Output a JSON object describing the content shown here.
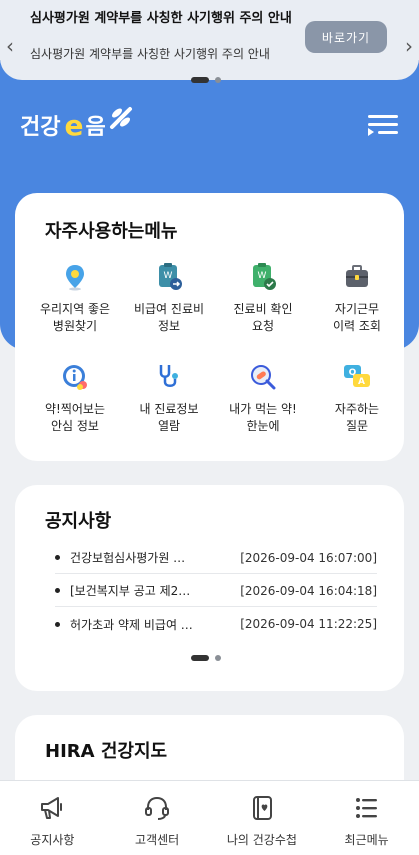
{
  "banner": {
    "title": "심사평가원 계약부를 사칭한 사기행위 주의 안내",
    "subtitle": "심사평가원 계약부를 사칭한 사기행위 주의 안내",
    "button_label": "바로가기"
  },
  "logo": {
    "prefix": "건강",
    "e": "e",
    "suffix": "음"
  },
  "quick_menu": {
    "title": "자주사용하는메뉴",
    "items": [
      {
        "label": "우리지역 좋은\n병원찾기",
        "icon": "hospital-location-icon"
      },
      {
        "label": "비급여 진료비\n정보",
        "icon": "non-covered-cost-icon"
      },
      {
        "label": "진료비 확인\n요청",
        "icon": "cost-check-icon"
      },
      {
        "label": "자기근무\n이력 조회",
        "icon": "work-history-icon"
      },
      {
        "label": "약!찍어보는\n안심 정보",
        "icon": "drug-info-icon"
      },
      {
        "label": "내 진료정보\n열람",
        "icon": "stethoscope-icon"
      },
      {
        "label": "내가 먹는 약!\n한눈에",
        "icon": "my-medicine-icon"
      },
      {
        "label": "자주하는\n질문",
        "icon": "faq-icon"
      }
    ]
  },
  "notices": {
    "title": "공지사항",
    "items": [
      {
        "title": "건강보험심사평가원 …",
        "date": "[2026-09-04 16:07:00]"
      },
      {
        "title": "[보건복지부 공고 제2…",
        "date": "[2026-09-04 16:04:18]"
      },
      {
        "title": "허가초과 약제 비급여 …",
        "date": "[2026-09-04 11:22:25]"
      }
    ]
  },
  "hira": {
    "title": "HIRA 건강지도"
  },
  "bottom_nav": [
    {
      "label": "공지사항",
      "icon": "megaphone-icon"
    },
    {
      "label": "고객센터",
      "icon": "headset-icon"
    },
    {
      "label": "나의 건강수첩",
      "icon": "health-book-icon"
    },
    {
      "label": "최근메뉴",
      "icon": "list-icon"
    }
  ],
  "colors": {
    "primary": "#4a86e0",
    "accent": "#ffd93d"
  }
}
